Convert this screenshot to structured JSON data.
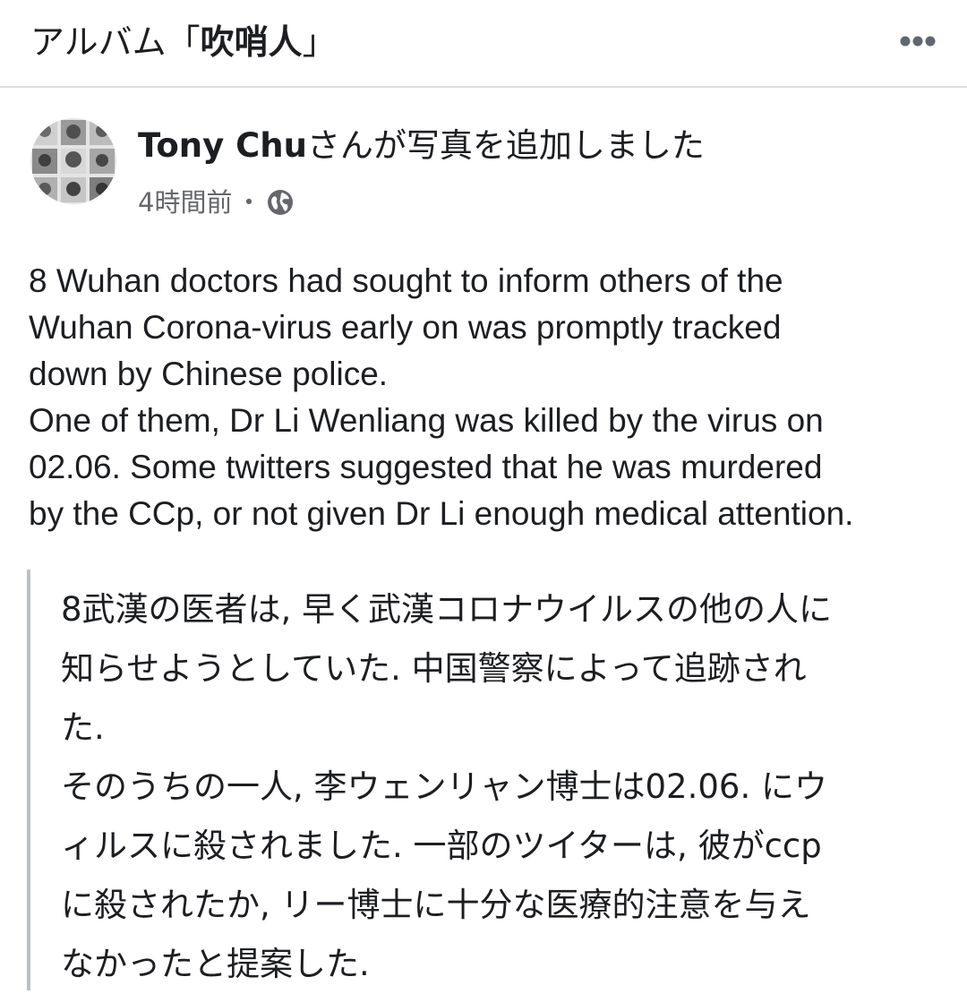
{
  "header": {
    "album_prefix": "アルバム「",
    "album_name": "吹哨人",
    "album_suffix": "」",
    "more_icon": "more-horizontal-icon"
  },
  "post": {
    "avatar_icon": "profile-photo-collage",
    "author": "Tony Chu",
    "action": "さんが写真を追加しました",
    "time": "4時間前",
    "separator": "・",
    "privacy_icon": "globe-icon",
    "body_lines": [
      "8 Wuhan doctors had sought to inform others of the",
      "Wuhan Corona-virus early on was promptly tracked",
      "down by Chinese police.",
      "One of them, Dr Li Wenliang was killed by the virus on",
      "02.06. Some twitters suggested that he was murdered",
      "by the CCp, or not given Dr Li enough medical attention."
    ],
    "quote_lines": [
      "8武漢の医者は, 早く武漢コロナウイルスの他の人に",
      "知らせようとしていた. 中国警察によって追跡され",
      "た.",
      "そのうちの一人, 李ウェンリャン博士は02.06. にウ",
      "ィルスに殺されました. 一部のツイターは, 彼がccp",
      "に殺されたか, リー博士に十分な医療的注意を与え",
      "なかったと提案した."
    ]
  },
  "colors": {
    "text": "#1c1e21",
    "meta": "#65676b",
    "divider": "#dadde1",
    "quote_bar": "#bcc0c4"
  }
}
